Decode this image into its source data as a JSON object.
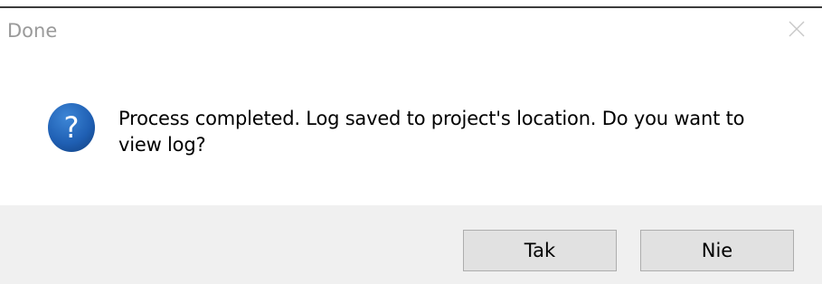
{
  "dialog": {
    "title": "Done",
    "message": "Process completed. Log saved to project's location. Do you want to view log?",
    "icon": "question-icon",
    "buttons": {
      "yes_label": "Tak",
      "no_label": "Nie"
    }
  },
  "colors": {
    "icon_blue": "#1f5fb3",
    "button_face": "#e1e1e1",
    "button_border": "#adadad",
    "footer_bg": "#f0f0f0",
    "title_text": "#9a9a9a"
  }
}
